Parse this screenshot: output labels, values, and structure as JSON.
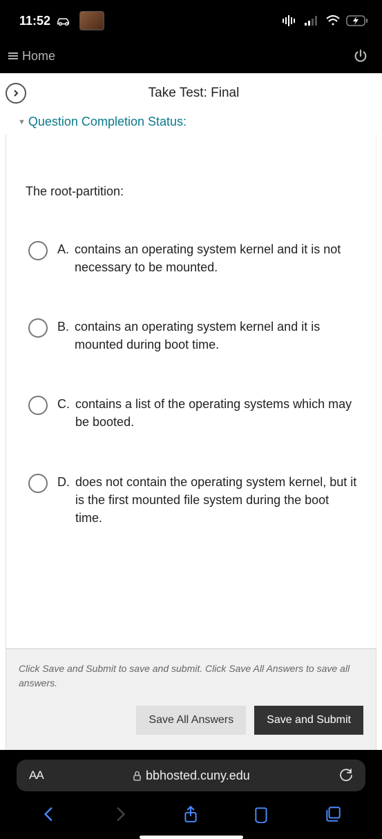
{
  "status": {
    "time": "11:52"
  },
  "nav": {
    "home_label": "Home"
  },
  "page": {
    "title": "Take Test: Final",
    "qc_status_label": "Question Completion Status:"
  },
  "question": {
    "prompt": "The root-partition:",
    "options": [
      {
        "letter": "A.",
        "text": "contains an operating system kernel and it is not necessary to be mounted."
      },
      {
        "letter": "B.",
        "text": "contains an operating system kernel and it is mounted during boot time."
      },
      {
        "letter": "C.",
        "text": "contains a list of the operating systems which may be booted."
      },
      {
        "letter": "D.",
        "text": "does not contain the operating system kernel, but it is the first mounted file system during the boot time."
      }
    ]
  },
  "footer": {
    "hint": "Click Save and Submit to save and submit. Click Save All Answers to save all answers.",
    "save_all_label": "Save All Answers",
    "submit_label": "Save and Submit"
  },
  "address_bar": {
    "aa": "AA",
    "url": "bbhosted.cuny.edu"
  }
}
